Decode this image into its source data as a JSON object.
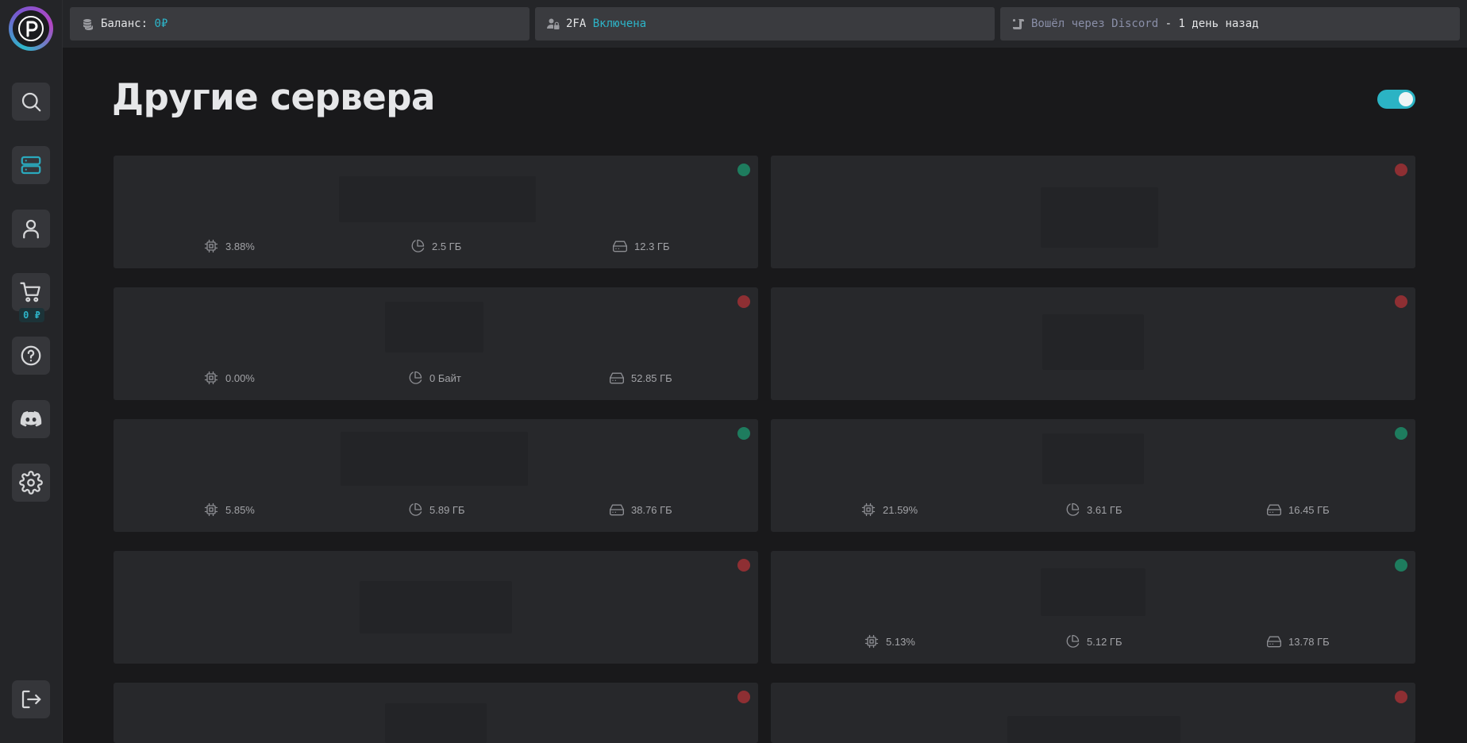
{
  "sidebar": {
    "logo_letter": "P",
    "items": [
      {
        "name": "search",
        "icon": "search-icon",
        "active": false
      },
      {
        "name": "servers",
        "icon": "server-icon",
        "active": true
      },
      {
        "name": "account",
        "icon": "user-icon",
        "active": false
      },
      {
        "name": "cart",
        "icon": "cart-icon",
        "active": false
      },
      {
        "name": "help",
        "icon": "help-icon",
        "active": false
      },
      {
        "name": "discord",
        "icon": "discord-icon",
        "active": false
      },
      {
        "name": "settings",
        "icon": "gear-icon",
        "active": false
      }
    ],
    "cart_badge": "0 ₽",
    "logout_icon": "logout-icon"
  },
  "header": {
    "balance_label": "Баланс:",
    "balance_value": "0₽",
    "twofa_label": "2FA",
    "twofa_value": "Включена",
    "login_text": "Вошёл через Discord",
    "login_time": "- 1 день назад"
  },
  "main": {
    "title": "Другие сервера",
    "toggle_on": true,
    "servers": [
      {
        "status": "online",
        "cpu": "3.88%",
        "ram": "2.5 ГБ",
        "disk": "12.3 ГБ"
      },
      {
        "status": "offline"
      },
      {
        "status": "offline",
        "cpu": "0.00%",
        "ram": "0 Байт",
        "disk": "52.85 ГБ"
      },
      {
        "status": "offline"
      },
      {
        "status": "online",
        "cpu": "5.85%",
        "ram": "5.89 ГБ",
        "disk": "38.76 ГБ"
      },
      {
        "status": "online",
        "cpu": "21.59%",
        "ram": "3.61 ГБ",
        "disk": "16.45 ГБ"
      },
      {
        "status": "offline"
      },
      {
        "status": "online",
        "cpu": "5.13%",
        "ram": "5.12 ГБ",
        "disk": "13.78 ГБ"
      },
      {
        "status": "offline"
      },
      {
        "status": "offline"
      }
    ]
  },
  "colors": {
    "accent": "#2db4c8",
    "online": "#1e7c5e",
    "offline": "#8e2f33",
    "background": "#19191b",
    "card": "#27282b"
  }
}
